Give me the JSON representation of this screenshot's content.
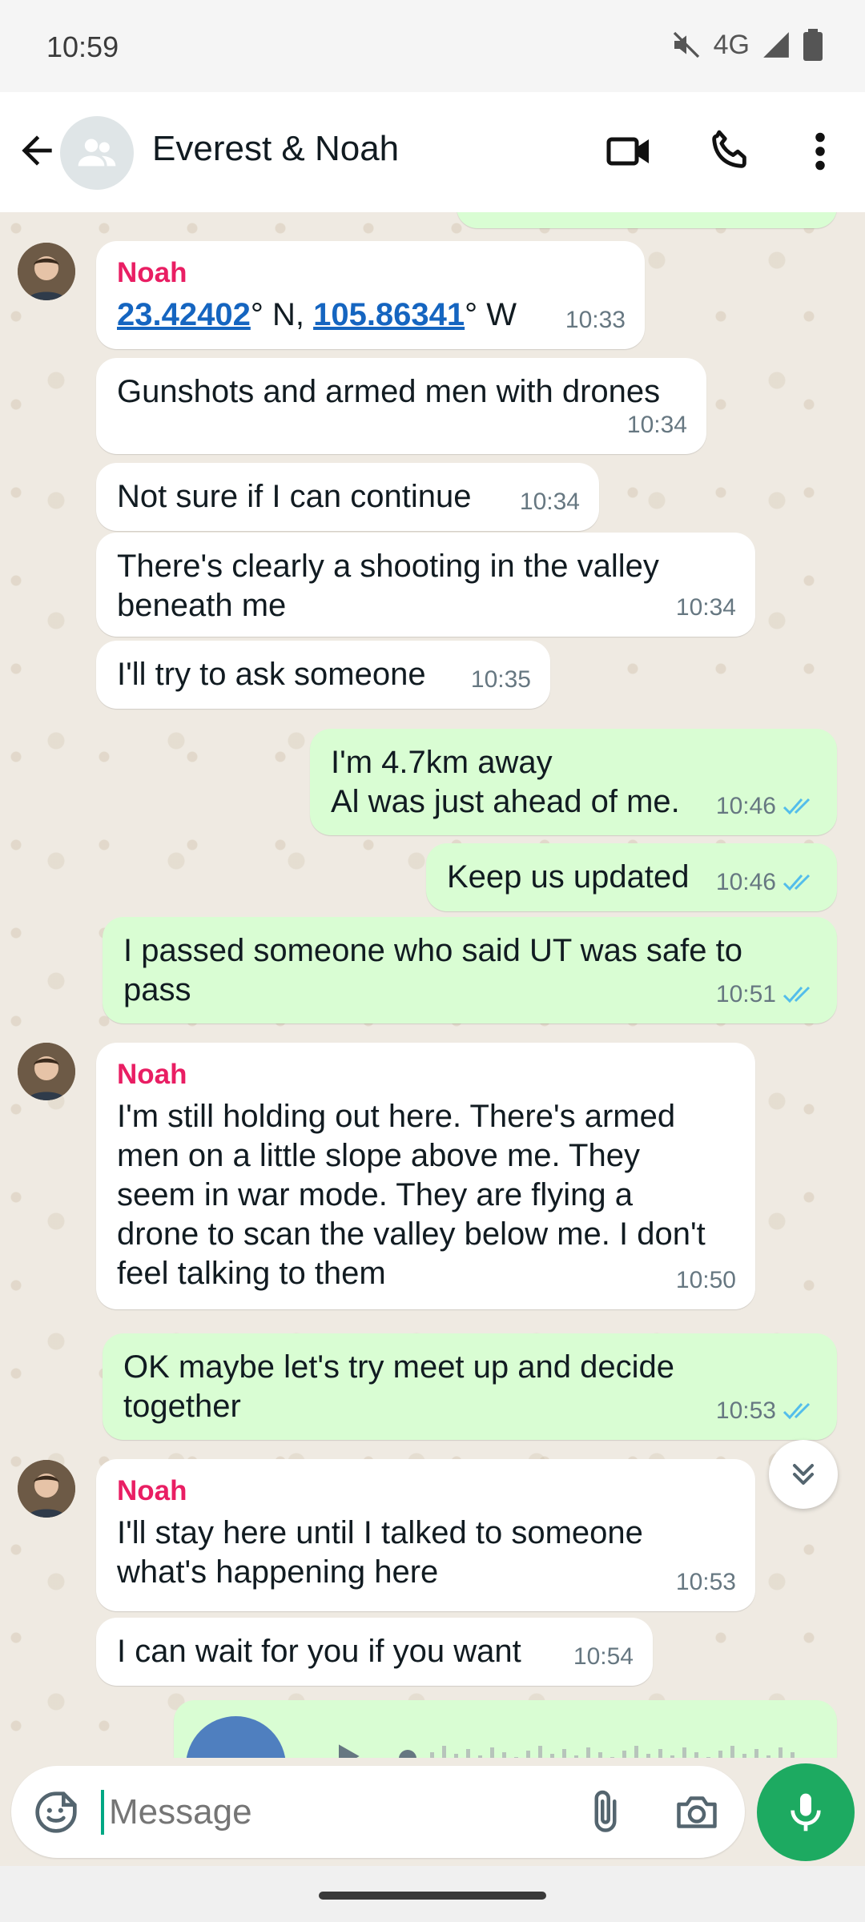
{
  "status_bar": {
    "time": "10:59",
    "network": "4G"
  },
  "header": {
    "title": "Everest & Noah"
  },
  "messages": [
    {
      "sender": "Noah",
      "lat": "23.42402",
      "lat_suffix": "° N, ",
      "lon": "105.86341",
      "lon_suffix": "° W",
      "time": "10:33"
    },
    {
      "text": "Gunshots and armed men with drones",
      "time": "10:34"
    },
    {
      "text": "Not sure if I can continue",
      "time": "10:34"
    },
    {
      "text": "There's clearly a shooting in the valley\nbeneath me",
      "time": "10:34"
    },
    {
      "text": "I'll try to ask someone",
      "time": "10:35"
    },
    {
      "text": "I'm 4.7km away\nAl was just ahead of me.",
      "time": "10:46"
    },
    {
      "text": "Keep us updated",
      "time": "10:46"
    },
    {
      "text": "I passed someone who said UT was safe to\npass",
      "time": "10:51"
    },
    {
      "sender": "Noah",
      "text": "I'm still holding out here. There's armed\nmen on a little slope above me. They\nseem in war mode. They are flying a\ndrone to scan the valley below me. I don't\nfeel talking to them",
      "time": "10:50"
    },
    {
      "text": "OK maybe let's try meet up and decide\ntogether",
      "time": "10:53"
    },
    {
      "sender": "Noah",
      "text": "I'll stay here until I talked to someone\nwhat's happening here",
      "time": "10:53"
    },
    {
      "text": "I can wait for you if you want",
      "time": "10:54"
    }
  ],
  "composer": {
    "placeholder": "Message"
  },
  "colors": {
    "outgoing_bubble": "#d9fdd3",
    "incoming_bubble": "#ffffff",
    "sender_name": "#e91e63",
    "read_ticks": "#53bdeb",
    "mic_button": "#1daa61",
    "link": "#1565c0"
  },
  "icons": [
    "back-arrow-icon",
    "group-avatar-icon",
    "video-call-icon",
    "voice-call-icon",
    "more-options-icon",
    "double-check-icon",
    "scroll-down-icon",
    "sticker-icon",
    "attach-icon",
    "camera-icon",
    "mic-icon",
    "play-icon",
    "mute-icon",
    "signal-icon",
    "battery-icon"
  ]
}
